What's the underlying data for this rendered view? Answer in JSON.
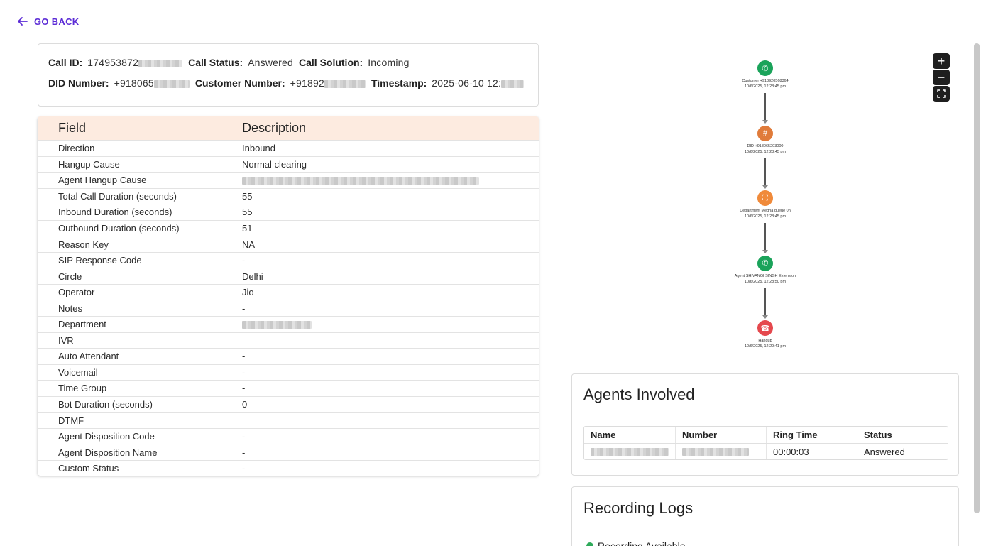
{
  "nav": {
    "go_back_label": "GO BACK"
  },
  "call_info": {
    "call_id_label": "Call ID:",
    "call_id_value": "174953872",
    "call_status_label": "Call Status:",
    "call_status_value": "Answered",
    "call_solution_label": "Call Solution:",
    "call_solution_value": "Incoming",
    "did_label": "DID Number:",
    "did_value": "+918065",
    "customer_label": "Customer Number:",
    "customer_value": "+91892",
    "timestamp_label": "Timestamp:",
    "timestamp_value": "2025-06-10 12:"
  },
  "field_table": {
    "headers": [
      "Field",
      "Description"
    ],
    "rows": [
      [
        "Direction",
        "Inbound"
      ],
      [
        "Hangup Cause",
        "Normal clearing"
      ],
      [
        "Agent Hangup Cause",
        ""
      ],
      [
        "Total Call Duration (seconds)",
        "55"
      ],
      [
        "Inbound Duration (seconds)",
        "55"
      ],
      [
        "Outbound Duration (seconds)",
        "51"
      ],
      [
        "Reason Key",
        "NA"
      ],
      [
        "SIP Response Code",
        "-"
      ],
      [
        "Circle",
        "Delhi"
      ],
      [
        "Operator",
        "Jio"
      ],
      [
        "Notes",
        "-"
      ],
      [
        "Department",
        ""
      ],
      [
        "IVR",
        ""
      ],
      [
        "Auto Attendant",
        "-"
      ],
      [
        "Voicemail",
        "-"
      ],
      [
        "Time Group",
        "-"
      ],
      [
        "Bot Duration (seconds)",
        "0"
      ],
      [
        "DTMF",
        ""
      ],
      [
        "Agent Disposition Code",
        "-"
      ],
      [
        "Agent Disposition Name",
        "-"
      ],
      [
        "Custom Status",
        "-"
      ]
    ]
  },
  "flow": {
    "nodes": [
      {
        "label": "Customer +918920568364",
        "time": "10/6/2025, 12:28:45 pm",
        "color": "#1aa35a",
        "icon": "phone-incoming-icon"
      },
      {
        "label": "DID +918065203000",
        "time": "10/6/2025, 12:28:45 pm",
        "color": "#e07b3a",
        "icon": "hash-icon"
      },
      {
        "label": "Department Megha queue 0n",
        "time": "10/6/2025, 12:28:45 pm",
        "color": "#f08a3a",
        "icon": "department-icon"
      },
      {
        "label": "Agent SHIVANGI SINGH Extension",
        "time": "10/6/2025, 12:28:50 pm",
        "color": "#1aa35a",
        "icon": "phone-call-icon"
      },
      {
        "label": "Hangup",
        "time": "10/6/2025, 12:29:41 pm",
        "color": "#e5484d",
        "icon": "hangup-icon"
      }
    ]
  },
  "agents": {
    "title": "Agents Involved",
    "headers": [
      "Name",
      "Number",
      "Ring Time",
      "Status"
    ],
    "rows": [
      {
        "name": "",
        "number": "",
        "ring_time": "00:00:03",
        "status": "Answered"
      }
    ]
  },
  "recording": {
    "title": "Recording Logs",
    "status_text": "Recording Available"
  }
}
